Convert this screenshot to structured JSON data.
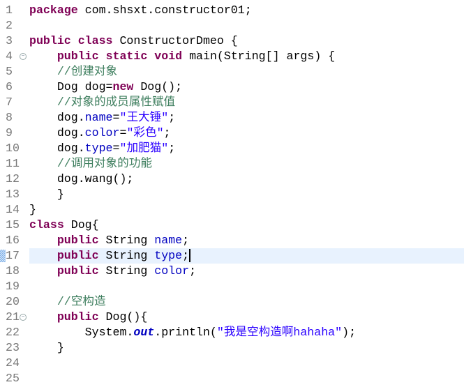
{
  "editor": {
    "current_line": 17,
    "folds": [
      4,
      21
    ],
    "lines": [
      [
        [
          "kw",
          "package"
        ],
        [
          "pl",
          " com.shsxt.constructor01;"
        ]
      ],
      [],
      [
        [
          "kw",
          "public"
        ],
        [
          "pl",
          " "
        ],
        [
          "kw",
          "class"
        ],
        [
          "pl",
          " ConstructorDmeo {"
        ]
      ],
      [
        [
          "pl",
          "    "
        ],
        [
          "kw",
          "public"
        ],
        [
          "pl",
          " "
        ],
        [
          "kw",
          "static"
        ],
        [
          "pl",
          " "
        ],
        [
          "kw",
          "void"
        ],
        [
          "pl",
          " main(String[] args) {"
        ]
      ],
      [
        [
          "pl",
          "    "
        ],
        [
          "cm",
          "//创建对象"
        ]
      ],
      [
        [
          "pl",
          "    Dog dog="
        ],
        [
          "kw",
          "new"
        ],
        [
          "pl",
          " Dog();"
        ]
      ],
      [
        [
          "pl",
          "    "
        ],
        [
          "cm",
          "//对象的成员属性赋值"
        ]
      ],
      [
        [
          "pl",
          "    dog."
        ],
        [
          "fld",
          "name"
        ],
        [
          "pl",
          "="
        ],
        [
          "str",
          "\"王大锤\""
        ],
        [
          "pl",
          ";"
        ]
      ],
      [
        [
          "pl",
          "    dog."
        ],
        [
          "fld",
          "color"
        ],
        [
          "pl",
          "="
        ],
        [
          "str",
          "\"彩色\""
        ],
        [
          "pl",
          ";"
        ]
      ],
      [
        [
          "pl",
          "    dog."
        ],
        [
          "fld",
          "type"
        ],
        [
          "pl",
          "="
        ],
        [
          "str",
          "\"加肥猫\""
        ],
        [
          "pl",
          ";"
        ]
      ],
      [
        [
          "pl",
          "    "
        ],
        [
          "cm",
          "//调用对象的功能"
        ]
      ],
      [
        [
          "pl",
          "    dog.wang();"
        ]
      ],
      [
        [
          "pl",
          "    }"
        ]
      ],
      [
        [
          "pl",
          "}"
        ]
      ],
      [
        [
          "kw",
          "class"
        ],
        [
          "pl",
          " Dog{"
        ]
      ],
      [
        [
          "pl",
          "    "
        ],
        [
          "kw",
          "public"
        ],
        [
          "pl",
          " String "
        ],
        [
          "fld",
          "name"
        ],
        [
          "pl",
          ";"
        ]
      ],
      [
        [
          "pl",
          "    "
        ],
        [
          "kw",
          "public"
        ],
        [
          "pl",
          " String "
        ],
        [
          "fld",
          "type"
        ],
        [
          "pl",
          ";"
        ]
      ],
      [
        [
          "pl",
          "    "
        ],
        [
          "kw",
          "public"
        ],
        [
          "pl",
          " String "
        ],
        [
          "fld",
          "color"
        ],
        [
          "pl",
          ";"
        ]
      ],
      [],
      [
        [
          "pl",
          "    "
        ],
        [
          "cm",
          "//空构造"
        ]
      ],
      [
        [
          "pl",
          "    "
        ],
        [
          "kw",
          "public"
        ],
        [
          "pl",
          " Dog(){"
        ]
      ],
      [
        [
          "pl",
          "        System."
        ],
        [
          "st",
          "out"
        ],
        [
          "pl",
          ".println("
        ],
        [
          "str",
          "\"我是空构造啊hahaha\""
        ],
        [
          "pl",
          ");"
        ]
      ],
      [
        [
          "pl",
          "    }"
        ]
      ],
      [],
      []
    ]
  }
}
